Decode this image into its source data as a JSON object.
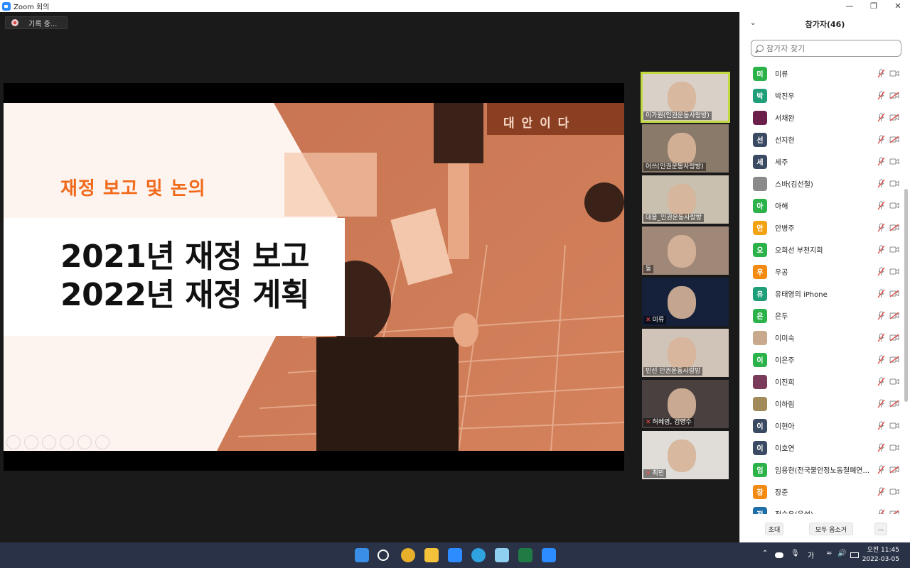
{
  "window": {
    "title": "Zoom 회의"
  },
  "recording": {
    "label": "기록 중..."
  },
  "slide": {
    "subtitle": "재정 보고 및 논의",
    "title_line1": "2021년 재정 보고",
    "title_line2": "2022년 재정 계획",
    "photo_sign": "대 안 이 다"
  },
  "video_tiles": [
    {
      "name": "이가원(인권운동사랑방)",
      "active": true,
      "muted": false
    },
    {
      "name": "어쓰(인권운동사랑방)",
      "active": false,
      "muted": false
    },
    {
      "name": "대용_인권운동사랑방",
      "active": false,
      "muted": false
    },
    {
      "name": "동",
      "active": false,
      "muted": false
    },
    {
      "name": "미류",
      "active": false,
      "muted": true
    },
    {
      "name": "민선 인권운동사랑방",
      "active": false,
      "muted": false
    },
    {
      "name": "허혜영, 김영수",
      "active": false,
      "muted": true
    },
    {
      "name": "최민",
      "active": false,
      "muted": true
    }
  ],
  "participants_panel": {
    "title": "참가자(46)",
    "search_placeholder": "참가자 찾기",
    "participants": [
      {
        "initial": "미",
        "name": "미류",
        "color": "#2bb34a",
        "photo": false,
        "video_off": false
      },
      {
        "initial": "박",
        "name": "박진우",
        "color": "#1e9e79",
        "photo": false,
        "video_off": true
      },
      {
        "initial": "",
        "name": "서채완",
        "color": "#6b1f4a",
        "photo": true,
        "video_off": true
      },
      {
        "initial": "선",
        "name": "선지현",
        "color": "#3b4a63",
        "photo": false,
        "video_off": true
      },
      {
        "initial": "세",
        "name": "세주",
        "color": "#3b4a63",
        "photo": false,
        "video_off": false
      },
      {
        "initial": "",
        "name": "스바(김선철)",
        "color": "#8a8a8a",
        "photo": true,
        "video_off": false
      },
      {
        "initial": "아",
        "name": "아해",
        "color": "#2bb34a",
        "photo": false,
        "video_off": false
      },
      {
        "initial": "안",
        "name": "안병주",
        "color": "#f3a312",
        "photo": false,
        "video_off": true
      },
      {
        "initial": "오",
        "name": "오희선 부천지회",
        "color": "#2bb34a",
        "photo": false,
        "video_off": false
      },
      {
        "initial": "우",
        "name": "우공",
        "color": "#f38b12",
        "photo": false,
        "video_off": false
      },
      {
        "initial": "유",
        "name": "유태영의 iPhone",
        "color": "#1e9e79",
        "photo": false,
        "video_off": true
      },
      {
        "initial": "은",
        "name": "은두",
        "color": "#2bb34a",
        "photo": false,
        "video_off": true
      },
      {
        "initial": "",
        "name": "이미숙",
        "color": "#c9a98c",
        "photo": true,
        "video_off": true
      },
      {
        "initial": "이",
        "name": "이은주",
        "color": "#2bb34a",
        "photo": false,
        "video_off": true
      },
      {
        "initial": "",
        "name": "이진희",
        "color": "#7a3a5a",
        "photo": true,
        "video_off": false
      },
      {
        "initial": "",
        "name": "이하림",
        "color": "#a38a5a",
        "photo": true,
        "video_off": true
      },
      {
        "initial": "이",
        "name": "이현아",
        "color": "#3b4a63",
        "photo": false,
        "video_off": false
      },
      {
        "initial": "이",
        "name": "이호연",
        "color": "#3b4a63",
        "photo": false,
        "video_off": false
      },
      {
        "initial": "임",
        "name": "임용현(전국불안정노동철폐연...",
        "color": "#2bb34a",
        "photo": false,
        "video_off": true
      },
      {
        "initial": "장",
        "name": "장준",
        "color": "#f38b12",
        "photo": false,
        "video_off": false
      },
      {
        "initial": "전",
        "name": "전승우(은설)",
        "color": "#1e6fa8",
        "photo": false,
        "video_off": true
      }
    ],
    "footer": {
      "invite": "초대",
      "mute_all": "모두 음소거",
      "more": "..."
    }
  },
  "taskbar": {
    "ime": "가",
    "time": "오전 11:45",
    "date": "2022-03-05"
  },
  "colors": {
    "accent_orange": "#f06a1b",
    "active_speaker": "#c3d941",
    "zoom_blue": "#2d8cff",
    "muted_red": "#e8413c"
  }
}
